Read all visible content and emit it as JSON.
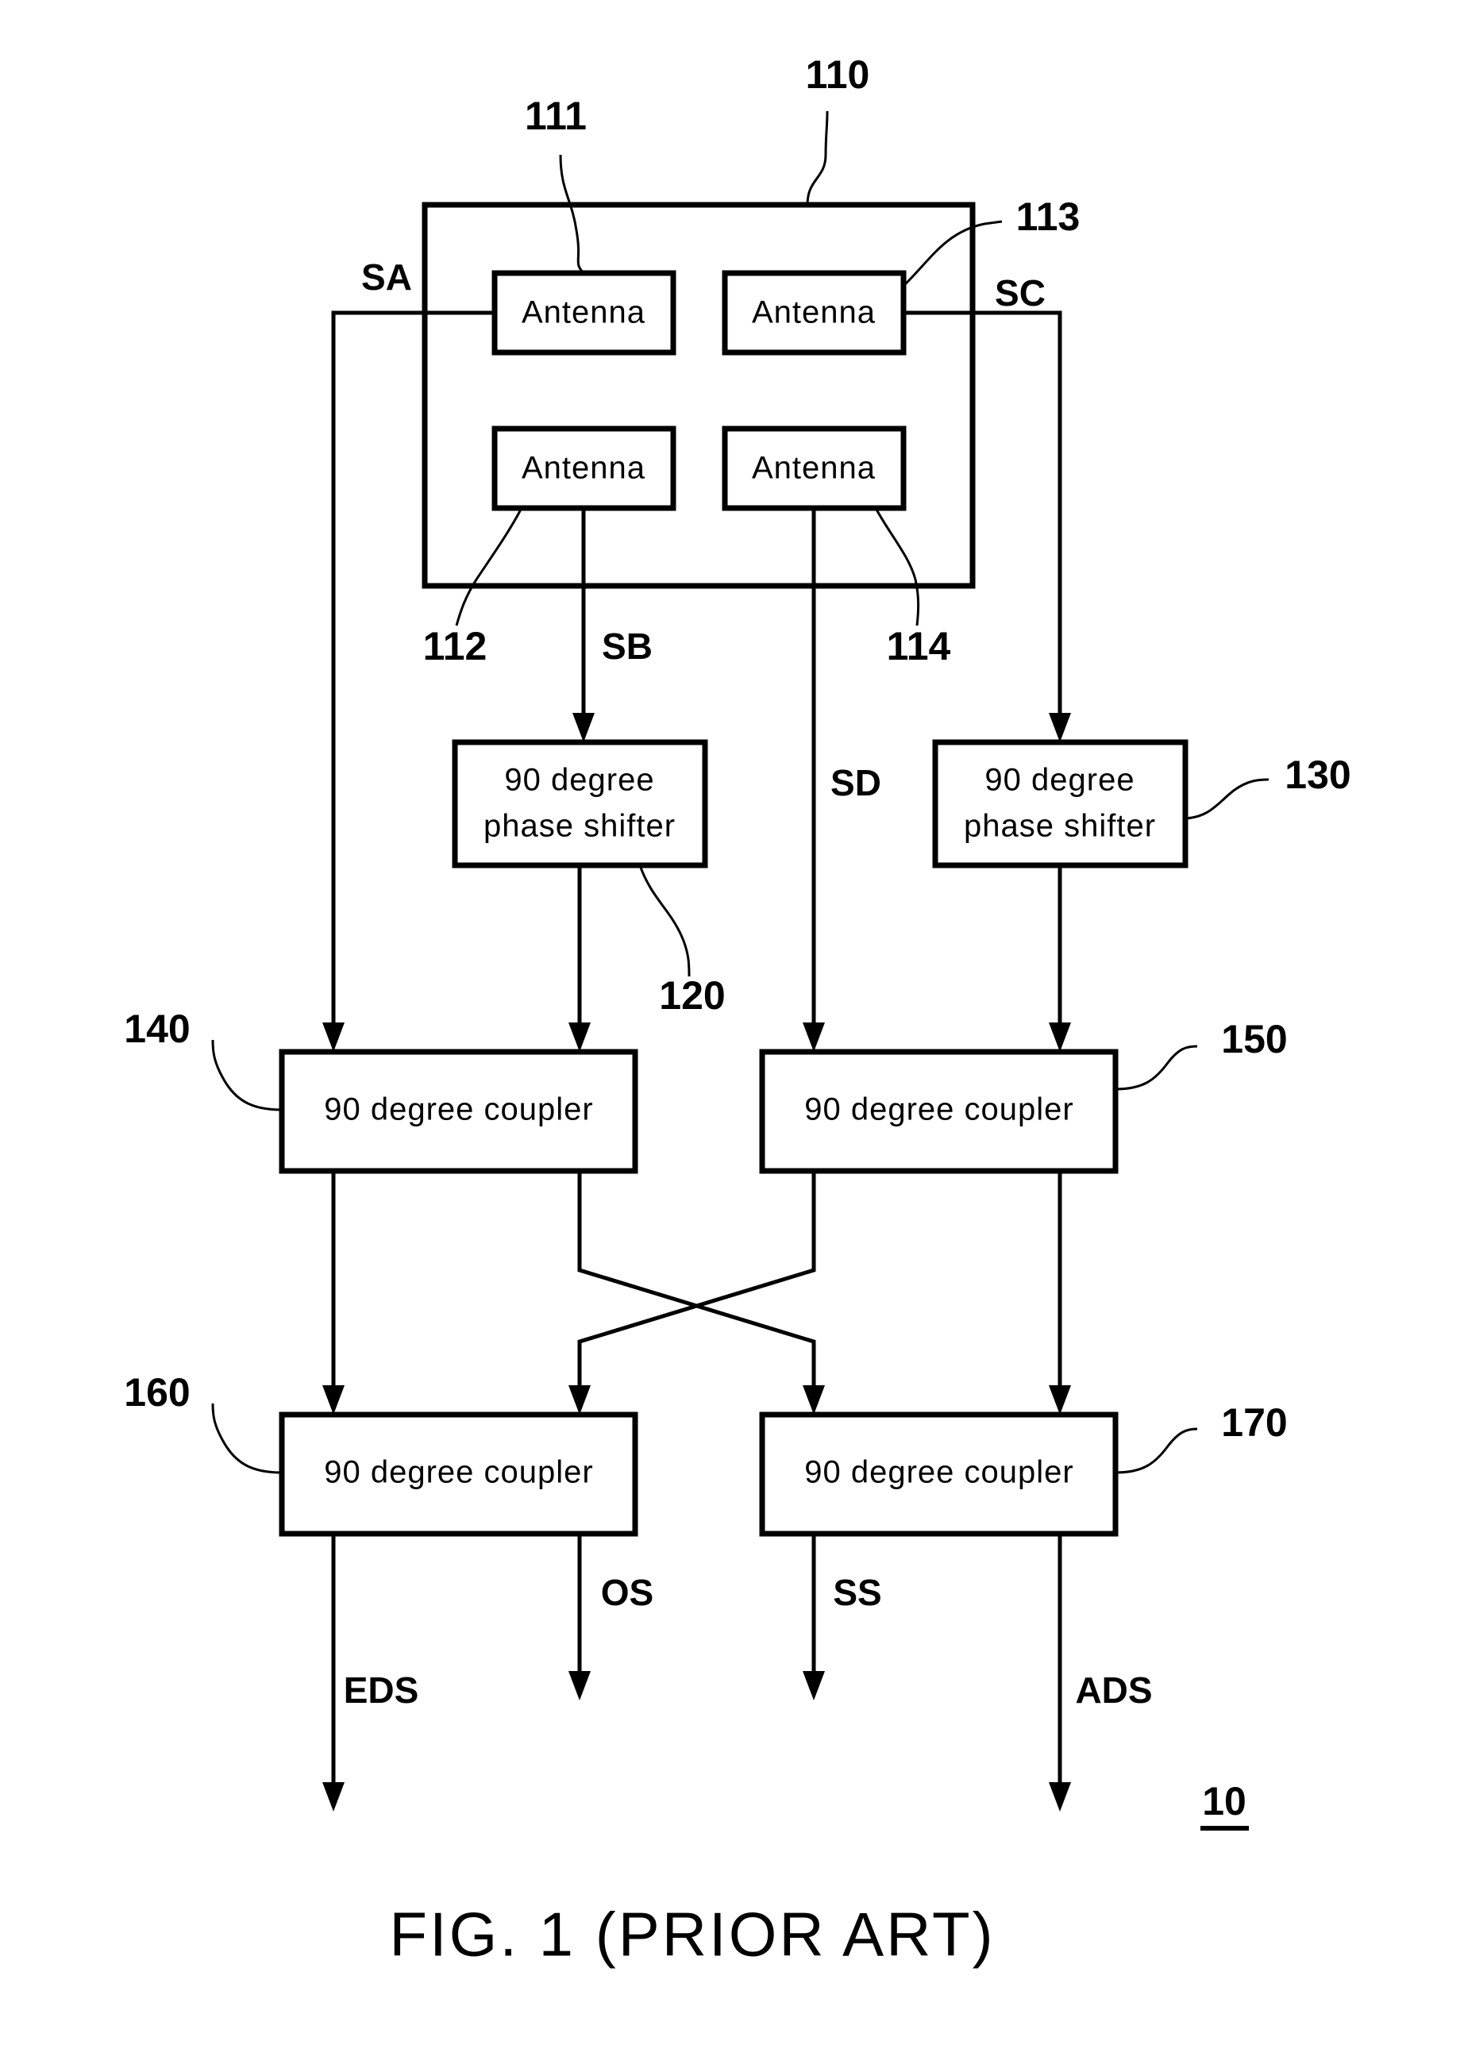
{
  "figure": {
    "caption": "FIG. 1 (PRIOR ART)",
    "system_ref": "10"
  },
  "antenna_module": {
    "ref": "110",
    "antennas": [
      {
        "ref": "111",
        "label": "Antenna"
      },
      {
        "ref": "113",
        "label": "Antenna"
      },
      {
        "ref": "112",
        "label": "Antenna"
      },
      {
        "ref": "114",
        "label": "Antenna"
      }
    ]
  },
  "phase_shifters": [
    {
      "ref": "120",
      "line1": "90 degree",
      "line2": "phase shifter"
    },
    {
      "ref": "130",
      "line1": "90 degree",
      "line2": "phase shifter"
    }
  ],
  "couplers": [
    {
      "ref": "140",
      "label": "90 degree coupler"
    },
    {
      "ref": "150",
      "label": "90 degree coupler"
    },
    {
      "ref": "160",
      "label": "90 degree coupler"
    },
    {
      "ref": "170",
      "label": "90 degree coupler"
    }
  ],
  "signals": {
    "sa": "SA",
    "sb": "SB",
    "sc": "SC",
    "sd": "SD"
  },
  "outputs": {
    "eds": "EDS",
    "os": "OS",
    "ss": "SS",
    "ads": "ADS"
  }
}
